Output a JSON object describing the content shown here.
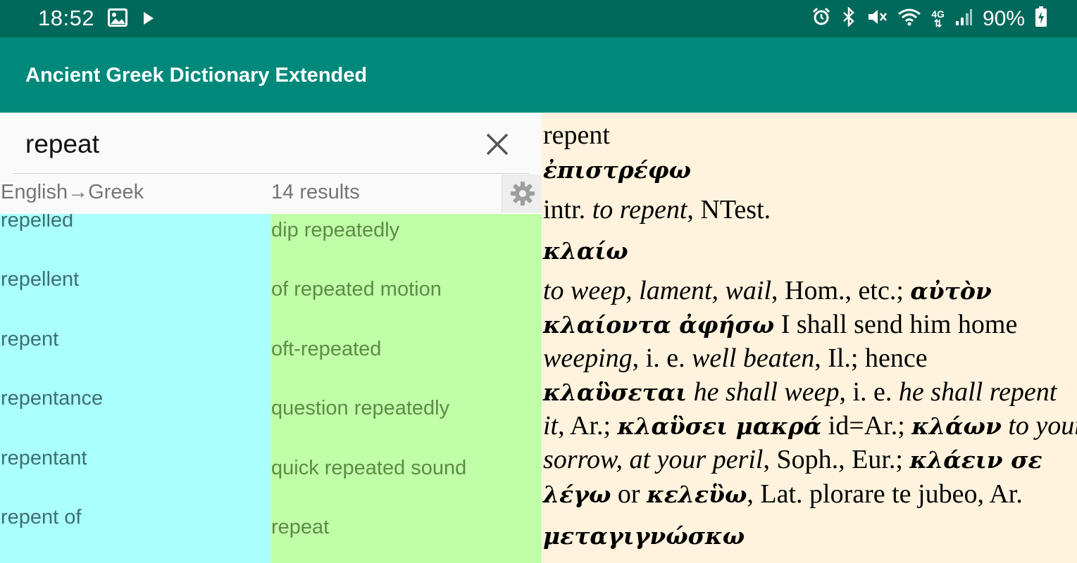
{
  "status_bar": {
    "time": "18:52",
    "battery": "90%",
    "icons": [
      "image-icon",
      "play-icon",
      "alarm-icon",
      "bluetooth-icon",
      "mute-icon",
      "wifi-icon",
      "4g-icon",
      "signal-icon",
      "battery-charging-icon"
    ]
  },
  "app_bar": {
    "title": "Ancient Greek Dictionary Extended"
  },
  "search": {
    "value": "repeat"
  },
  "info": {
    "direction": "English→Greek",
    "count": "14 results"
  },
  "left_list": [
    "repelled",
    "repellent",
    "repent",
    "repentance",
    "repentant",
    "repent of"
  ],
  "right_list": [
    "dip repeatedly",
    "of repeated motion",
    "oft-repeated",
    "question repeatedly",
    "quick repeated sound",
    "repeat"
  ],
  "entry": {
    "headword": "repent",
    "t1": "ἐπιστρέφω",
    "d1a": "intr. ",
    "d1b": "to repent",
    "d1c": ", NTest.",
    "t2": "κλαίω",
    "d2a": "to weep, lament, wail",
    "d2b": ", Hom., etc.; ",
    "d2c": "αὐτὸν",
    "d3a": "κλαίοντα ἀφήσω",
    "d3b": " I shall send him home",
    "d4a": "weeping",
    "d4b": ", i. e. ",
    "d4c": "well beaten",
    "d4d": ", Il.; hence",
    "d5a": "κλαὓσεται",
    "d5b": " he shall weep",
    "d5c": ", i. e. ",
    "d5d": "he shall repent",
    "d6a": "it",
    "d6b": ", Ar.; ",
    "d6c": "κλαὓσει μακρά",
    "d6d": " id=Ar.; ",
    "d6e": "κλάων",
    "d6f": " to your",
    "d7a": "sorrow, at your peril",
    "d7b": ", Soph., Eur.; ",
    "d7c": "κλάειν σε",
    "d8a": "λέγω",
    "d8b": " or ",
    "d8c": "κελεὓω",
    "d8d": ", Lat. plorare te jubeo, Ar.",
    "t3": "μεταγιγνώσκω"
  }
}
